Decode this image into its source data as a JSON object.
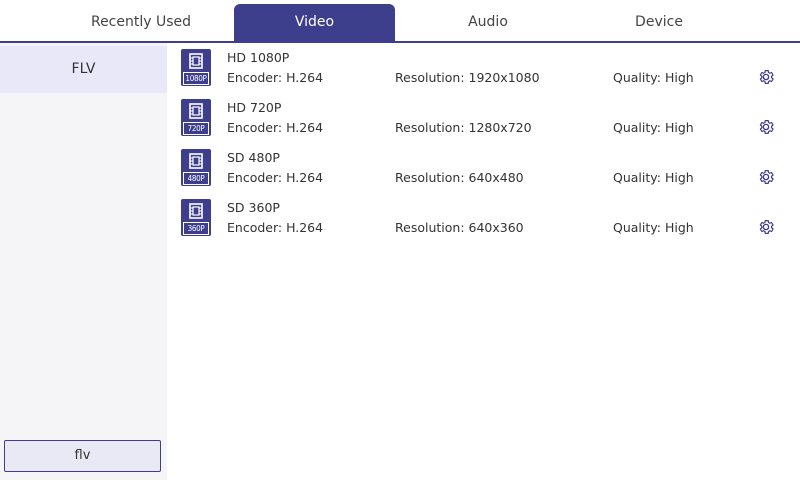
{
  "tabs": [
    {
      "label": "Recently Used",
      "active": false
    },
    {
      "label": "Video",
      "active": true
    },
    {
      "label": "Audio",
      "active": false
    },
    {
      "label": "Device",
      "active": false
    }
  ],
  "sidebar": {
    "items": [
      {
        "label": "FLV",
        "selected": true
      }
    ],
    "format_box": "flv"
  },
  "profiles": [
    {
      "badge": "1080P",
      "title": "HD 1080P",
      "encoder": "Encoder: H.264",
      "resolution": "Resolution: 1920x1080",
      "quality": "Quality: High",
      "icon": "film-icon"
    },
    {
      "badge": "720P",
      "title": "HD 720P",
      "encoder": "Encoder: H.264",
      "resolution": "Resolution: 1280x720",
      "quality": "Quality: High",
      "icon": "film-icon"
    },
    {
      "badge": "480P",
      "title": "SD 480P",
      "encoder": "Encoder: H.264",
      "resolution": "Resolution: 640x480",
      "quality": "Quality: High",
      "icon": "film-icon"
    },
    {
      "badge": "360P",
      "title": "SD 360P",
      "encoder": "Encoder: H.264",
      "resolution": "Resolution: 640x360",
      "quality": "Quality: High",
      "icon": "film-icon"
    }
  ],
  "colors": {
    "accent": "#3d3e8c",
    "sidebar_bg": "#f5f5f8",
    "sidebar_selected": "#e8e8f8"
  }
}
